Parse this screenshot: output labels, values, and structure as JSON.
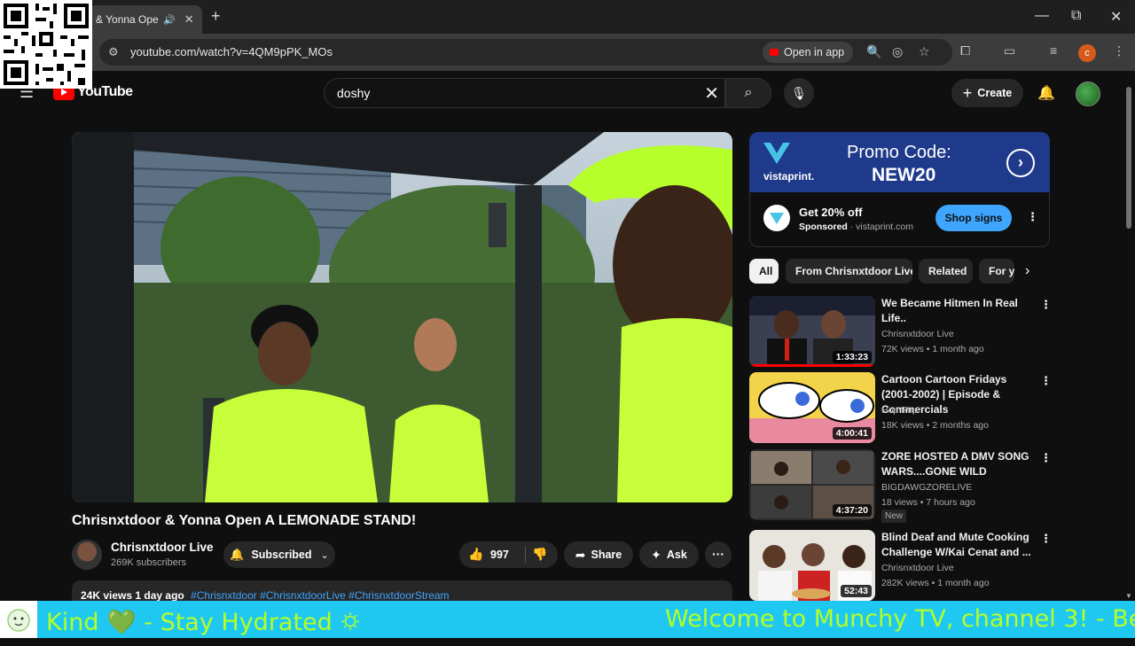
{
  "browser": {
    "tab_title": "& Yonna Ope",
    "tab_audio_icon": "speaker-icon",
    "tab_close": "✕",
    "new_tab": "+",
    "url": "youtube.com/watch?v=4QM9pPK_MOs",
    "open_in_app": "Open in app",
    "profile_initial": "c",
    "window_controls": {
      "minimize": "—",
      "restore": "⧉",
      "close": "✕"
    }
  },
  "youtube": {
    "logo_text": "YouTube",
    "search_query": "doshy",
    "create_label": "Create"
  },
  "video": {
    "title": "Chrisnxtdoor & Yonna Open A LEMONADE STAND!",
    "channel_name": "Chrisnxtdoor Live",
    "subscribers": "269K subscribers",
    "subscribe_label": "Subscribed",
    "likes": "997",
    "share_label": "Share",
    "ask_label": "Ask",
    "views_date": "24K views  1 day ago",
    "hashtags": "#Chrisnxtdoor #ChrisnxtdoorLive #ChrisnxtdoorStream"
  },
  "ad": {
    "brand": "vistaprint.",
    "promo_line1": "Promo Code:",
    "promo_line2": "NEW20",
    "headline": "Get 20% off",
    "sponsored": "Sponsored",
    "domain": "· vistaprint.com",
    "cta": "Shop signs"
  },
  "chips": [
    "All",
    "From Chrisnxtdoor Live",
    "Related",
    "For y"
  ],
  "recommendations": [
    {
      "title": "We Became Hitmen In Real Life..",
      "channel": "Chrisnxtdoor Live",
      "meta": "72K views • 1 month ago",
      "duration": "1:33:23"
    },
    {
      "title": "Cartoon Cartoon Fridays (2001-2002) | Episode & Commercials",
      "channel": "Hop Pop",
      "meta": "18K views • 2 months ago",
      "duration": "4:00:41"
    },
    {
      "title": "ZORE HOSTED A DMV SONG WARS....GONE WILD",
      "channel": "BIGDAWGZORELIVE",
      "meta": "18 views • 7 hours ago",
      "duration": "4:37:20",
      "badge": "New"
    },
    {
      "title": "Blind Deaf and Mute Cooking Challenge W/Kai Cenat and ...",
      "channel": "Chrisnxtdoor Live",
      "meta": "282K views • 1 month ago",
      "duration": "52:43"
    }
  ],
  "ticker": {
    "left_text": "Kind 💚 - Stay Hydrated 🌣",
    "right_text": "Welcome to Munchy TV, channel 3!  - Be"
  }
}
